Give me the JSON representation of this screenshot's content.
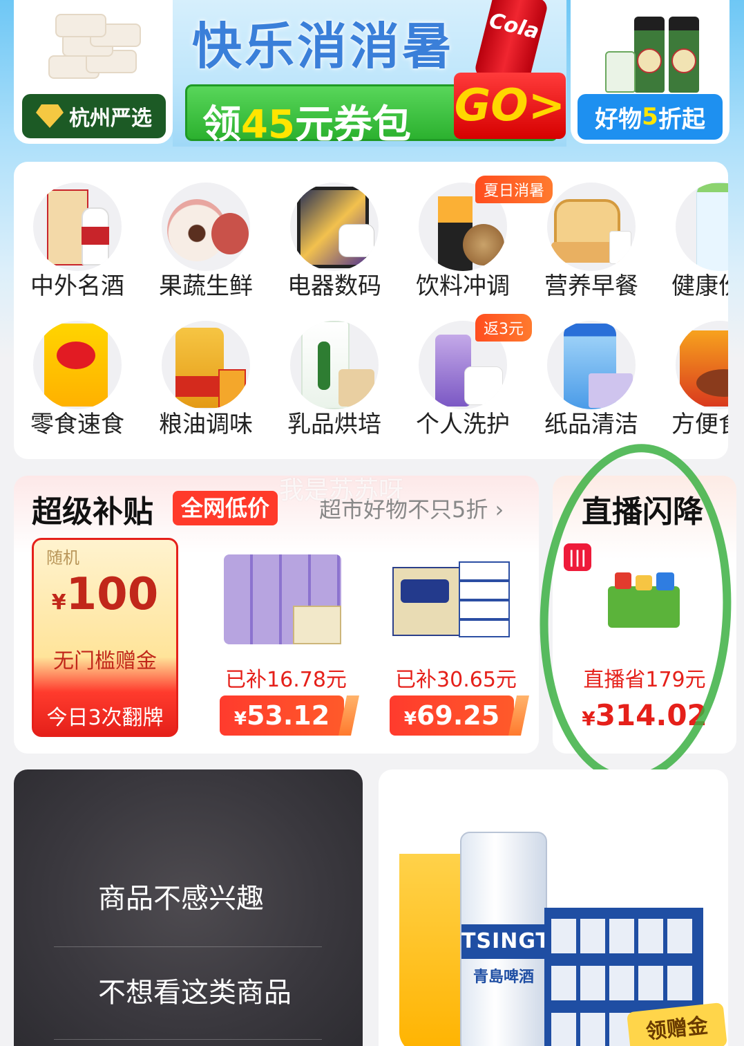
{
  "banner": {
    "left_tag": "杭州严选",
    "mid_title": "快乐消消暑",
    "cola_text": "Cola",
    "coupon_prefix": "领",
    "coupon_amount": "45",
    "coupon_suffix": "元券包",
    "go_label": "GO>",
    "right_tag_prefix": "好物",
    "right_tag_num": "5",
    "right_tag_suffix": "折起"
  },
  "categories": [
    {
      "label": "中外名酒",
      "icon": "liquor-icon"
    },
    {
      "label": "果蔬生鲜",
      "icon": "lychee-icon"
    },
    {
      "label": "电器数码",
      "icon": "tablet-icon"
    },
    {
      "label": "饮料冲调",
      "icon": "drink-icon",
      "badge": "夏日消暑"
    },
    {
      "label": "营养早餐",
      "icon": "bread-icon"
    },
    {
      "label": "健康份",
      "icon": "water-bottle-icon"
    },
    {
      "label": "零食速食",
      "icon": "chips-icon"
    },
    {
      "label": "粮油调味",
      "icon": "oil-icon"
    },
    {
      "label": "乳品烘培",
      "icon": "milk-icon"
    },
    {
      "label": "个人洗护",
      "icon": "skincare-icon",
      "badge": "返3元"
    },
    {
      "label": "纸品清洁",
      "icon": "detergent-icon"
    },
    {
      "label": "方便食",
      "icon": "noodle-icon"
    }
  ],
  "subsidy": {
    "title": "超级补贴",
    "badge": "全网低价",
    "link": "超市好物不只5折 ›",
    "lucky": {
      "tag": "随机",
      "currency": "¥",
      "amount": "100",
      "subtitle": "无门槛赠金",
      "flip": "今日3次翻牌"
    },
    "products": [
      {
        "saved": "已补16.78元",
        "currency": "¥",
        "price": "53.12"
      },
      {
        "saved": "已补30.65元",
        "currency": "¥",
        "price": "69.25"
      }
    ]
  },
  "live": {
    "title": "直播闪降",
    "saved": "直播省179元",
    "currency": "¥",
    "price": "314.02"
  },
  "watermark": "我是苏苏呀",
  "menu": {
    "items": [
      "商品不感兴趣",
      "不想看这类商品"
    ]
  },
  "beer": {
    "can_brand": "TSINGTAO",
    "can_cn": "青島啤酒",
    "gift_tag": "领赠金"
  },
  "colors": {
    "accent_red": "#e5201a",
    "live_green_mark": "#3cb043"
  }
}
